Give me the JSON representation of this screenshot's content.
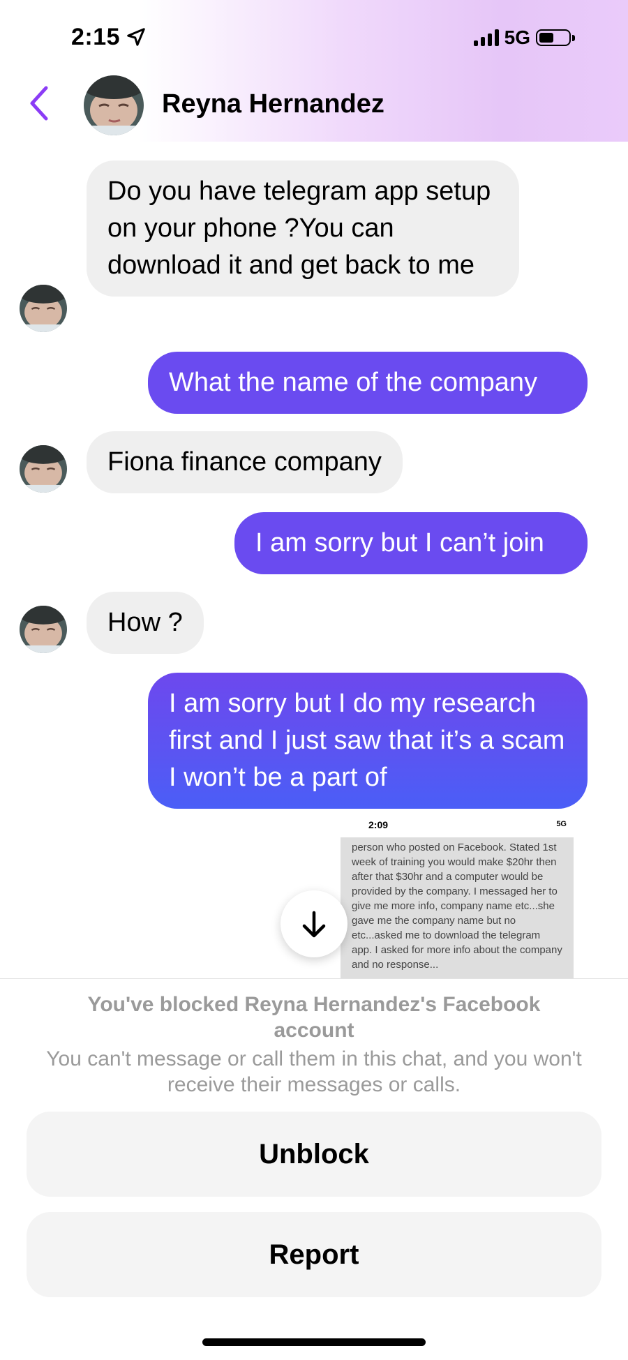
{
  "status_bar": {
    "time": "2:15",
    "network": "5G",
    "icons": [
      "location-arrow-icon",
      "signal-bars-icon",
      "battery-icon"
    ]
  },
  "header": {
    "contact_name": "Reyna Hernandez",
    "back_icon": "chevron-left-icon",
    "accent_color": "#8b3cf6"
  },
  "messages": [
    {
      "from": "them",
      "text": "Do you have telegram app setup on your phone ?You can download it and get back to me"
    },
    {
      "from": "me",
      "text": "What the name of the company"
    },
    {
      "from": "them",
      "text": "Fiona finance company"
    },
    {
      "from": "me",
      "text": "I am sorry but I can’t join"
    },
    {
      "from": "them",
      "text": "How ?"
    },
    {
      "from": "me",
      "text": "I am sorry but I do my research first and I just saw that it’s a scam I won’t be a part of"
    }
  ],
  "shared_screenshot": {
    "time": "2:09",
    "network": "5G",
    "text": "person who posted on Facebook. Stated 1st week of training you would make $20hr then after that $30hr and a computer would be provided by the company. I messaged her to give me more info, company name etc...she gave me the company name but no etc...asked me to download the telegram app. I asked for more info about the company and no response..."
  },
  "blocked_notice": {
    "title": "You've blocked Reyna Hernandez's Facebook account",
    "description": "You can't message or call them in this chat, and you won't receive their messages or calls."
  },
  "actions": {
    "unblock_label": "Unblock",
    "report_label": "Report"
  },
  "colors": {
    "incoming_bubble": "#efefef",
    "outgoing_bubble": "#6a4bf0",
    "muted_text": "#9a9a9a"
  }
}
